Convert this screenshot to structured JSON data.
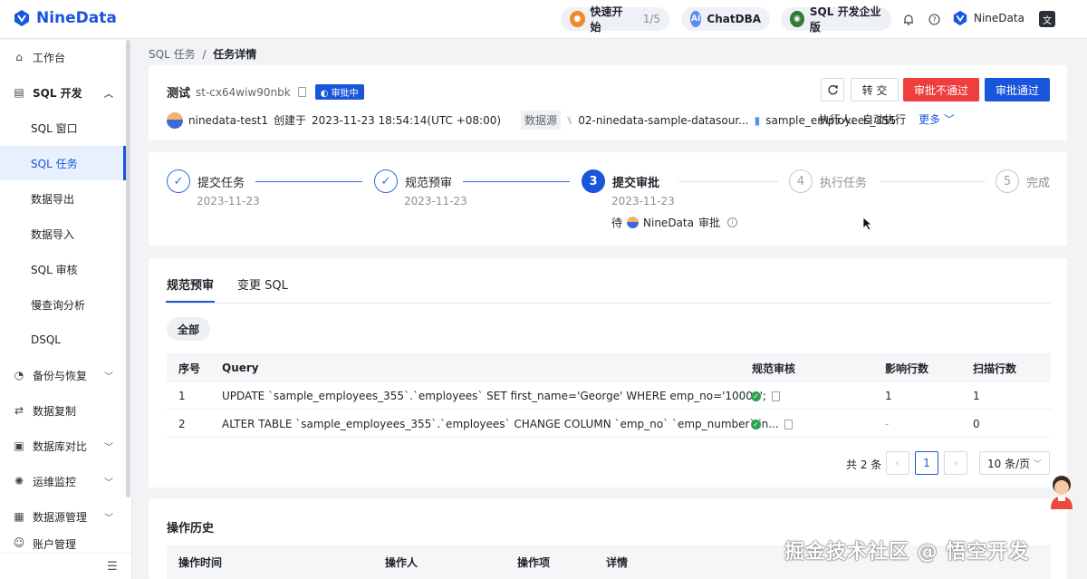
{
  "brand": {
    "name": "NineData"
  },
  "topbar": {
    "quick_start": "快速开始",
    "quick_progress": "1/5",
    "chatdba": "ChatDBA",
    "edition": "SQL 开发企业版",
    "user": "NineData"
  },
  "sidebar": {
    "items": [
      {
        "label": "工作台"
      },
      {
        "label": "SQL 开发"
      },
      {
        "label": "SQL 窗口"
      },
      {
        "label": "SQL 任务"
      },
      {
        "label": "数据导出"
      },
      {
        "label": "数据导入"
      },
      {
        "label": "SQL 审核"
      },
      {
        "label": "慢查询分析"
      },
      {
        "label": "DSQL"
      },
      {
        "label": "备份与恢复"
      },
      {
        "label": "数据复制"
      },
      {
        "label": "数据库对比"
      },
      {
        "label": "运维监控"
      },
      {
        "label": "数据源管理"
      },
      {
        "label": "账户管理"
      }
    ]
  },
  "breadcrumb": {
    "parent": "SQL 任务",
    "sep": "/",
    "current": "任务详情"
  },
  "task": {
    "name": "测试",
    "id": "st-cx64wiw90nbk",
    "status": "审批中",
    "creator": "ninedata-test1",
    "created_prefix": "创建于",
    "created_at": "2023-11-23 18:54:14(UTC +08:00)",
    "datasource_label": "数据源",
    "datasource": "02-ninedata-sample-datasour...",
    "database": "sample_employees_355",
    "executor_label": "执行人:",
    "executor": "自动执行",
    "more": "更多"
  },
  "actions": {
    "transfer": "转 交",
    "reject": "审批不通过",
    "approve": "审批通过"
  },
  "steps": [
    {
      "num": "1",
      "label": "提交任务",
      "date": "2023-11-23"
    },
    {
      "num": "2",
      "label": "规范预审",
      "date": "2023-11-23"
    },
    {
      "num": "3",
      "label": "提交审批",
      "date": "2023-11-23",
      "wait_prefix": "待",
      "wait_user": "NineData",
      "wait_suffix": "审批"
    },
    {
      "num": "4",
      "label": "执行任务"
    },
    {
      "num": "5",
      "label": "完成"
    }
  ],
  "tabs": {
    "precheck": "规范预审",
    "change_sql": "变更 SQL"
  },
  "filter": {
    "all": "全部"
  },
  "table": {
    "headers": [
      "序号",
      "Query",
      "规范审核",
      "影响行数",
      "扫描行数"
    ],
    "rows": [
      {
        "no": "1",
        "query": "UPDATE `sample_employees_355`.`employees` SET first_name='George' WHERE emp_no='10001';",
        "affected": "1",
        "scanned": "1"
      },
      {
        "no": "2",
        "query": "ALTER TABLE `sample_employees_355`.`employees` CHANGE COLUMN `emp_no` `emp_number` in...",
        "affected": "-",
        "scanned": "0"
      }
    ]
  },
  "pagination": {
    "total": "共 2 条",
    "page": "1",
    "page_size": "10 条/页"
  },
  "history": {
    "title": "操作历史",
    "headers": [
      "操作时间",
      "操作人",
      "操作项",
      "详情"
    ]
  },
  "watermark": "掘金技术社区 @ 悟空开发"
}
